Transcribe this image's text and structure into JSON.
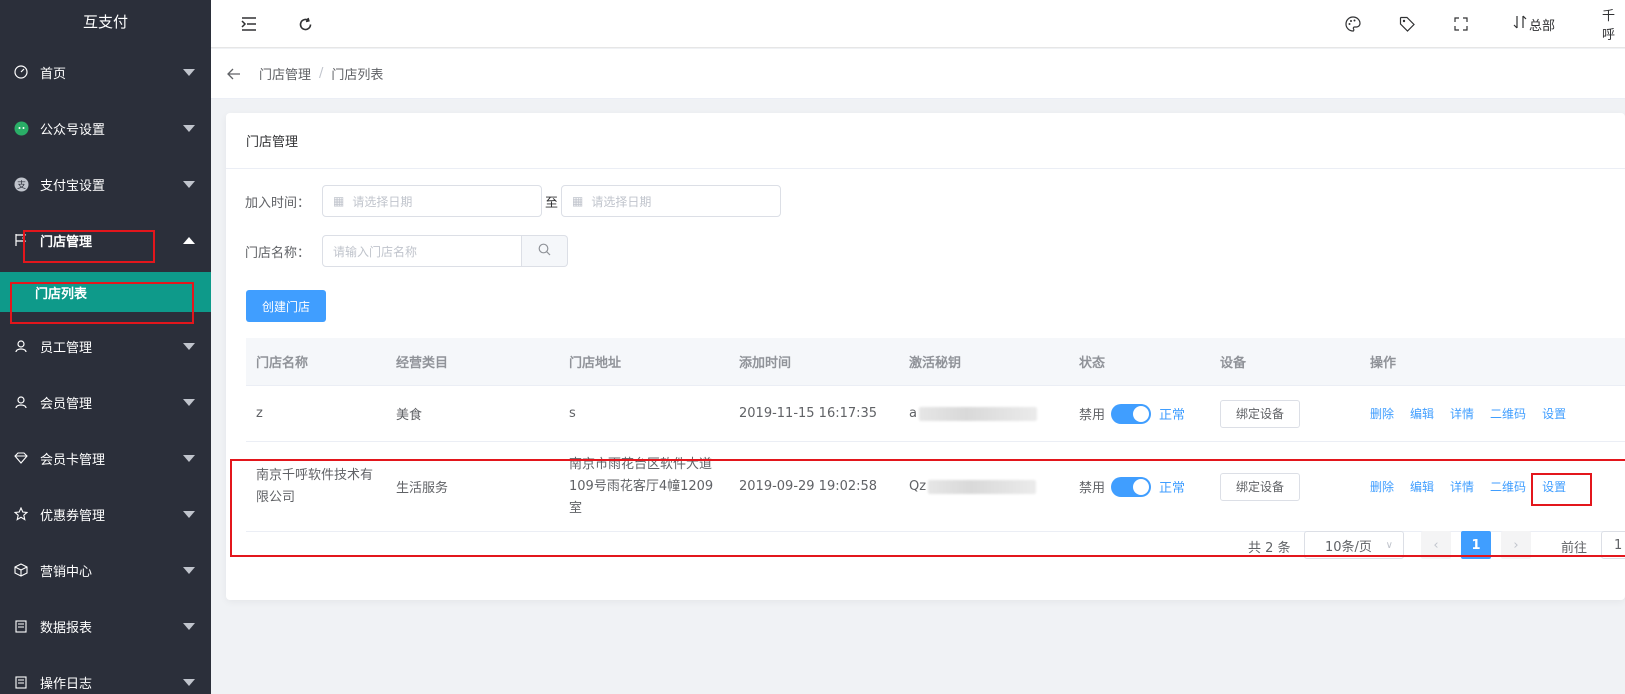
{
  "sidebar": {
    "logo": "互支付",
    "items": [
      {
        "label": "首页",
        "icon": "dashboard-icon"
      },
      {
        "label": "公众号设置",
        "icon": "wechat-icon"
      },
      {
        "label": "支付宝设置",
        "icon": "alipay-icon"
      },
      {
        "label": "门店管理",
        "icon": "flag-icon"
      },
      {
        "label": "员工管理",
        "icon": "user-icon"
      },
      {
        "label": "会员管理",
        "icon": "user-icon"
      },
      {
        "label": "会员卡管理",
        "icon": "diamond-icon"
      },
      {
        "label": "优惠券管理",
        "icon": "star-icon"
      },
      {
        "label": "营销中心",
        "icon": "cube-icon"
      },
      {
        "label": "数据报表",
        "icon": "clipboard-icon"
      },
      {
        "label": "操作日志",
        "icon": "clipboard-icon"
      }
    ],
    "sub_active": "门店列表"
  },
  "topbar": {
    "org": "总部",
    "user": "千呼"
  },
  "breadcrumb": [
    "门店管理",
    "门店列表"
  ],
  "card": {
    "title": "门店管理",
    "date_label": "加入时间：",
    "date_placeholder_start": "请选择日期",
    "date_sep": "至",
    "date_placeholder_end": "请选择日期",
    "name_label": "门店名称：",
    "name_placeholder": "请输入门店名称",
    "create_button": "创建门店"
  },
  "table": {
    "headers": [
      "门店名称",
      "经营类目",
      "门店地址",
      "添加时间",
      "激活秘钥",
      "状态",
      "设备",
      "操作"
    ],
    "rows": [
      {
        "name": "z",
        "category": "美食",
        "address": "s",
        "time": "2019-11-15 16:17:35",
        "key": "a",
        "status_off": "禁用",
        "status_on": "正常",
        "device_btn": "绑定设备",
        "actions": [
          "删除",
          "编辑",
          "详情",
          "二维码",
          "设置"
        ]
      },
      {
        "name": "南京千呼软件技术有限公司",
        "category": "生活服务",
        "address": "南京市雨花台区软件大道109号雨花客厅4幢1209室",
        "time": "2019-09-29 19:02:58",
        "key": "Qz",
        "status_off": "禁用",
        "status_on": "正常",
        "device_btn": "绑定设备",
        "actions": [
          "删除",
          "编辑",
          "详情",
          "二维码",
          "设置"
        ]
      }
    ]
  },
  "pagination": {
    "total": "共 2 条",
    "page_size": "10条/页",
    "current": "1",
    "goto_label": "前往",
    "goto_value": "1"
  },
  "colors": {
    "sidebar_bg": "#2b2f3a",
    "active_sub": "#0e9a8a",
    "primary": "#409eff",
    "highlight": "#e3161c"
  }
}
